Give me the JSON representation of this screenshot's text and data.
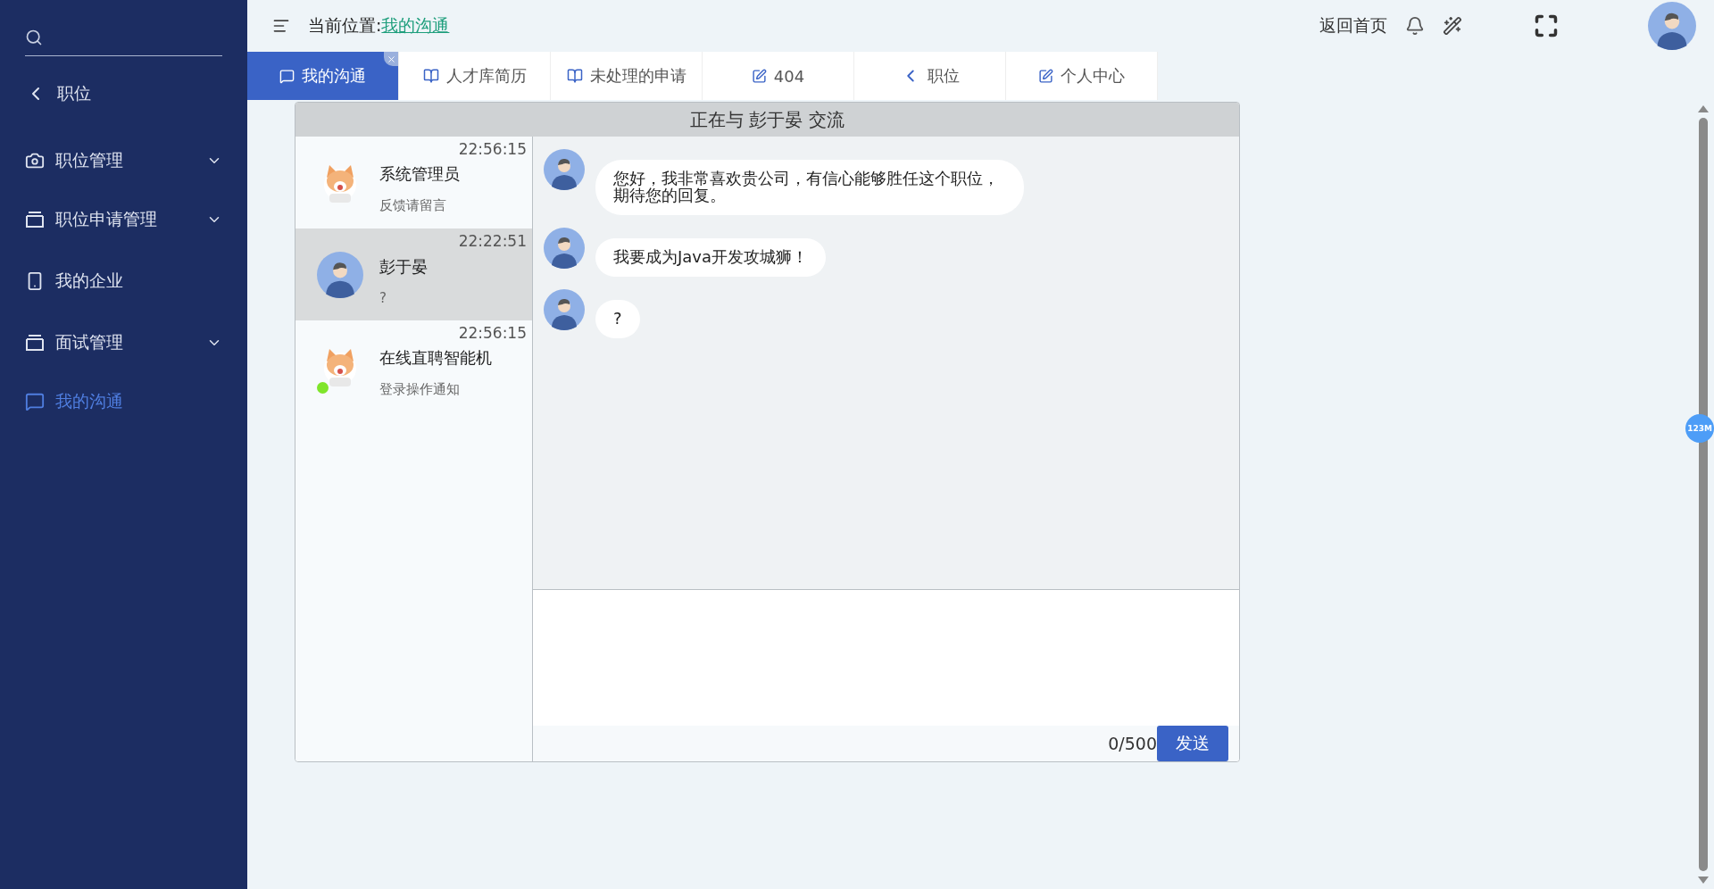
{
  "sidebar": {
    "back": {
      "label": "职位"
    },
    "items": [
      {
        "label": "职位管理",
        "kind": "camera",
        "expandable": true,
        "selected": false
      },
      {
        "label": "职位申请管理",
        "kind": "tray",
        "expandable": true,
        "selected": false
      },
      {
        "label": "我的企业",
        "kind": "phone",
        "expandable": false,
        "selected": false
      },
      {
        "label": "面试管理",
        "kind": "tray",
        "expandable": true,
        "selected": false
      },
      {
        "label": "我的沟通",
        "kind": "chat",
        "expandable": false,
        "selected": true
      }
    ]
  },
  "header": {
    "breadcrumb_label": "当前位置:",
    "breadcrumb_link": "我的沟通",
    "home_link": "返回首页"
  },
  "tabs": [
    {
      "label": "我的沟通",
      "kind": "chat",
      "selected": true
    },
    {
      "label": "人才库简历",
      "kind": "book",
      "selected": false
    },
    {
      "label": "未处理的申请",
      "kind": "book",
      "selected": false
    },
    {
      "label": "404",
      "kind": "edit",
      "selected": false
    },
    {
      "label": "职位",
      "kind": "back",
      "selected": false
    },
    {
      "label": "个人中心",
      "kind": "edit",
      "selected": false
    }
  ],
  "chat": {
    "title": "正在与 彭于晏 交流",
    "conversations": [
      {
        "name": "系统管理员",
        "preview": "反馈请留言",
        "time": "22:56:15",
        "kind": "cat",
        "selected": false,
        "online": false
      },
      {
        "name": "彭于晏",
        "preview": "?",
        "time": "22:22:51",
        "kind": "person",
        "selected": true,
        "online": false
      },
      {
        "name": "在线直聘智能机",
        "preview": "登录操作通知",
        "time": "22:56:15",
        "kind": "cat",
        "selected": false,
        "online": true
      }
    ],
    "messages": [
      {
        "text": "您好，我非常喜欢贵公司，有信心能够胜任这个职位，期待您的回复。"
      },
      {
        "text": "我要成为Java开发攻城狮！"
      },
      {
        "text": "?"
      }
    ],
    "input": {
      "counter": "0/500",
      "send": "发送"
    }
  },
  "memory_badge": "123M"
}
